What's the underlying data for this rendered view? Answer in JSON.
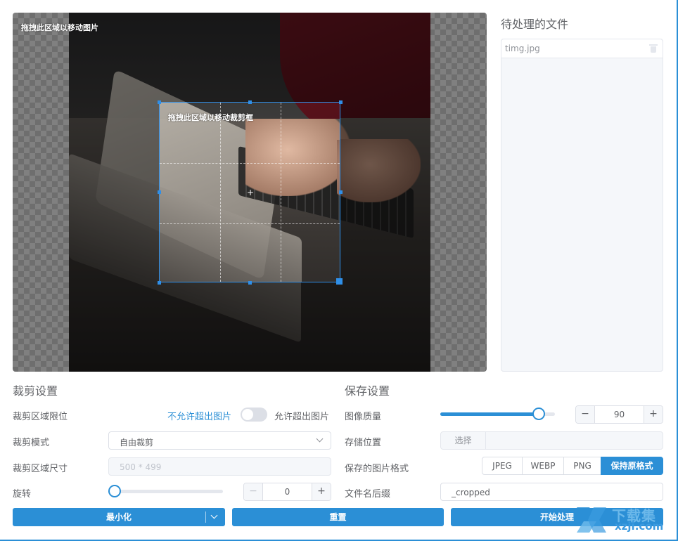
{
  "canvas": {
    "drag_image_hint": "拖拽此区域以移动图片",
    "drag_crop_hint": "拖拽此区域以移动裁剪框"
  },
  "files": {
    "title": "待处理的文件",
    "items": [
      {
        "name": "timg.jpg"
      }
    ]
  },
  "crop_settings": {
    "title": "裁剪设置",
    "limit_label": "裁剪区域限位",
    "limit_off_text": "不允许超出图片",
    "limit_on_text": "允许超出图片",
    "limit_enabled": false,
    "mode_label": "裁剪模式",
    "mode_value": "自由裁剪",
    "size_label": "裁剪区域尺寸",
    "size_value": "500 * 499",
    "rotate_label": "旋转",
    "rotate_value": "0",
    "rotate_fraction": 0.0,
    "minus": "−",
    "plus": "+"
  },
  "save_settings": {
    "title": "保存设置",
    "quality_label": "图像质量",
    "quality_value": "90",
    "quality_fraction": 0.9,
    "location_label": "存储位置",
    "choose_label": "选择",
    "location_value": "",
    "format_label": "保存的图片格式",
    "formats": [
      "JPEG",
      "WEBP",
      "PNG",
      "保持原格式"
    ],
    "selected_format": "保持原格式",
    "suffix_label": "文件名后缀",
    "suffix_value": "_cropped",
    "minus": "−",
    "plus": "+"
  },
  "actions": {
    "minimize": "最小化",
    "reset": "重置",
    "start": "开始处理"
  },
  "watermark": {
    "cn": "下载集",
    "en": "xzji.com"
  },
  "colors": {
    "accent": "#2b8fd6",
    "crop_border": "#2f8fe8"
  }
}
